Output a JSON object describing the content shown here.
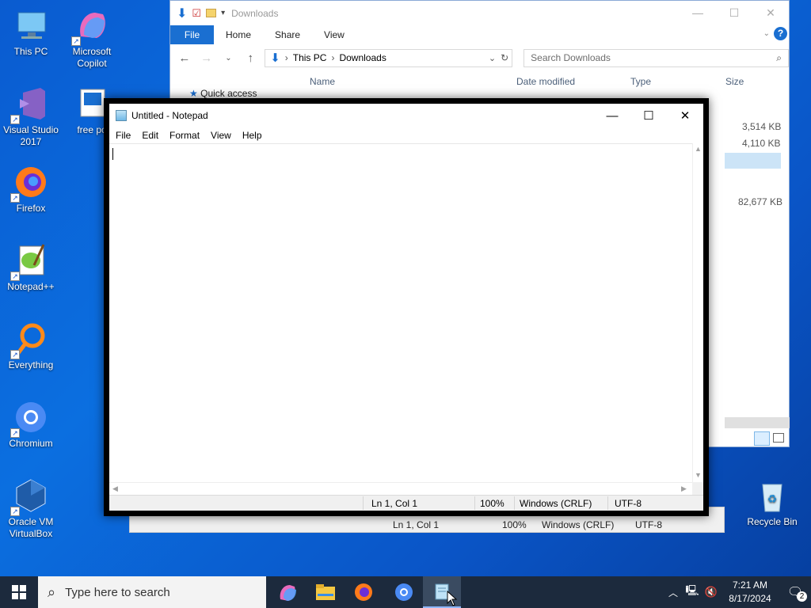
{
  "desktop": {
    "icons": [
      {
        "label": "This PC"
      },
      {
        "label": "Microsoft Copilot"
      },
      {
        "label": "Visual Studio 2017"
      },
      {
        "label": "free po"
      },
      {
        "label": "Firefox"
      },
      {
        "label": "Notepad++"
      },
      {
        "label": "Everything"
      },
      {
        "label": "Chromium"
      },
      {
        "label": "Oracle VM VirtualBox"
      },
      {
        "label": "Recycle Bin"
      }
    ]
  },
  "explorer": {
    "title": "Downloads",
    "ribbon": {
      "file": "File",
      "home": "Home",
      "share": "Share",
      "view": "View"
    },
    "address": {
      "root": "This PC",
      "folder": "Downloads"
    },
    "search_placeholder": "Search Downloads",
    "columns": {
      "name": "Name",
      "date": "Date modified",
      "type": "Type",
      "size": "Size"
    },
    "sidebar_quick_access": "Quick access",
    "sizes": [
      "3,514 KB",
      "4,110 KB",
      "82,677 KB"
    ]
  },
  "ghost_status": {
    "position": "Ln 1, Col 1",
    "zoom": "100%",
    "eol": "Windows (CRLF)",
    "encoding": "UTF-8"
  },
  "notepad": {
    "title": "Untitled - Notepad",
    "menu": {
      "file": "File",
      "edit": "Edit",
      "format": "Format",
      "view": "View",
      "help": "Help"
    },
    "status": {
      "position": "Ln 1, Col 1",
      "zoom": "100%",
      "eol": "Windows (CRLF)",
      "encoding": "UTF-8"
    }
  },
  "taskbar": {
    "search_placeholder": "Type here to search",
    "time": "7:21 AM",
    "date": "8/17/2024",
    "notification_count": "2"
  }
}
